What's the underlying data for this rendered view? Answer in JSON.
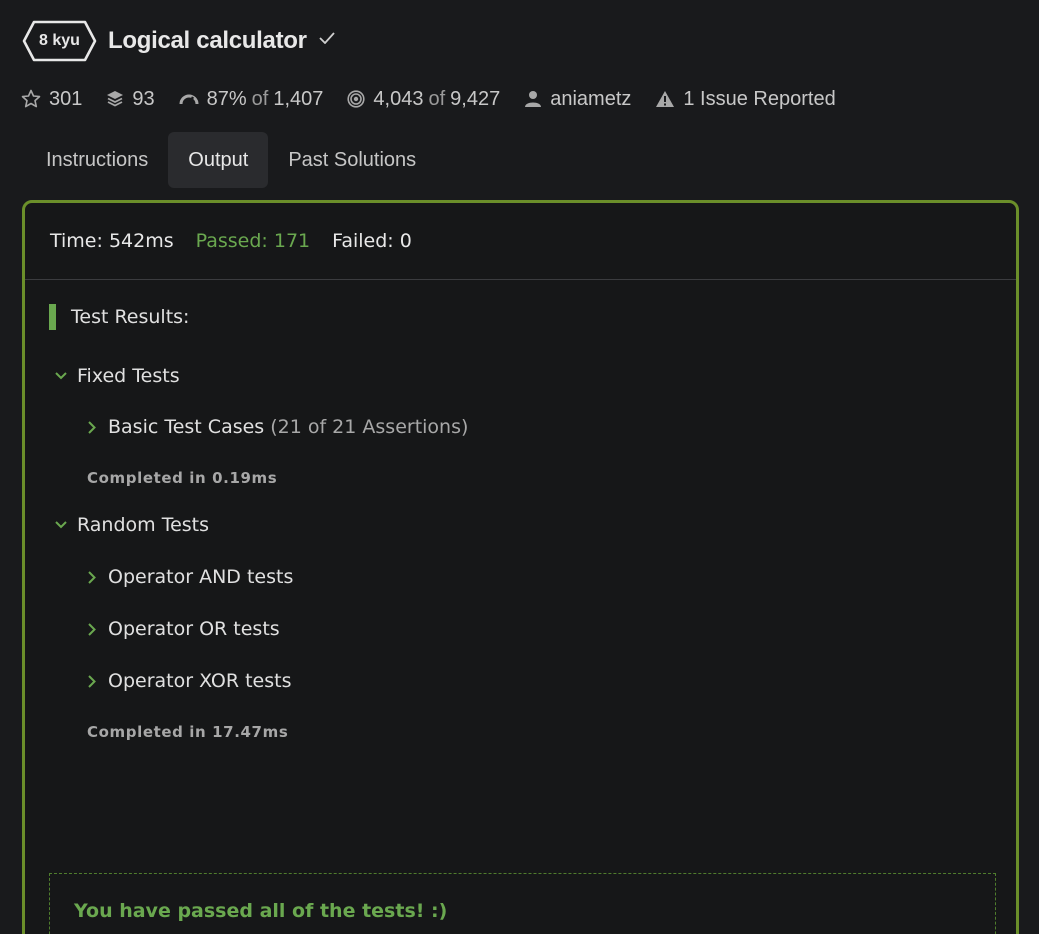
{
  "kata": {
    "rank": "8 kyu",
    "title": "Logical calculator"
  },
  "stats": {
    "stars": "301",
    "collections": "93",
    "satisfaction_pct": "87%",
    "satisfaction_of": "of",
    "satisfaction_votes": "1,407",
    "completed": "4,043",
    "completed_of": "of",
    "attempted": "9,427",
    "author": "aniametz",
    "issues": "1 Issue Reported"
  },
  "tabs": [
    {
      "label": "Instructions",
      "active": false
    },
    {
      "label": "Output",
      "active": true
    },
    {
      "label": "Past Solutions",
      "active": false
    }
  ],
  "summary": {
    "time": "Time: 542ms",
    "passed": "Passed: 171",
    "failed": "Failed: 0"
  },
  "results": {
    "heading": "Test Results:",
    "groups": [
      {
        "label": "Fixed Tests",
        "items": [
          {
            "label": "Basic Test Cases",
            "count": "(21 of 21 Assertions)"
          }
        ],
        "completed": "Completed in 0.19ms"
      },
      {
        "label": "Random Tests",
        "items": [
          {
            "label": "Operator AND tests"
          },
          {
            "label": "Operator OR tests"
          },
          {
            "label": "Operator XOR tests"
          }
        ],
        "completed": "Completed in 17.47ms"
      }
    ],
    "pass_message": "You have passed all of the tests! :)"
  },
  "colors": {
    "background": "#191a1c",
    "accent_green": "#6aa84f",
    "panel_border": "#6b8f2a"
  },
  "icons": {
    "stars": "star-icon",
    "collections": "stack-icon",
    "satisfaction": "gauge-icon",
    "completed": "target-icon",
    "author": "user-icon",
    "issues": "warning-icon",
    "verified": "check-icon",
    "expanded": "chevron-down-icon",
    "collapsed": "chevron-right-icon"
  }
}
